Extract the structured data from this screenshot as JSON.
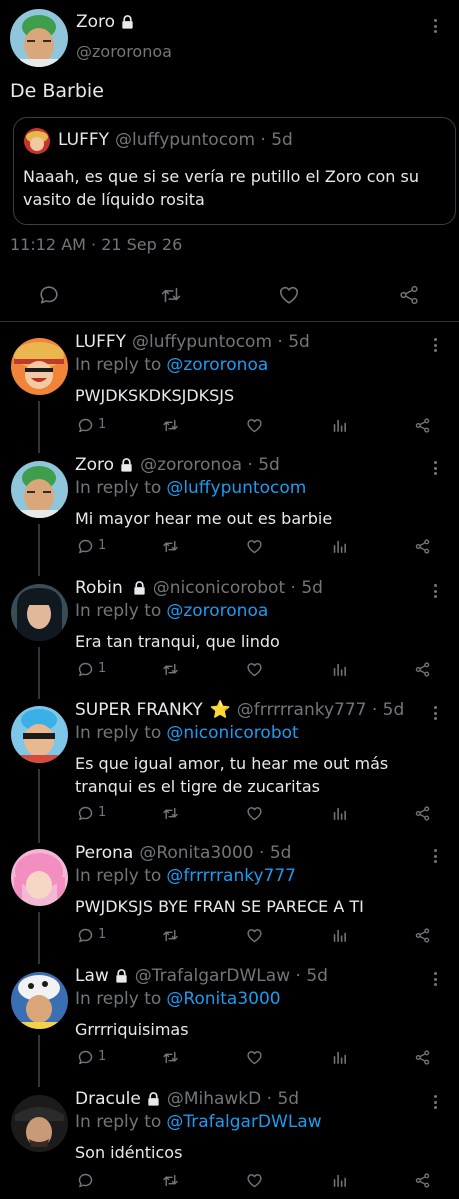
{
  "main_tweet": {
    "name": "Zoro",
    "handle": "@zororonoa",
    "text": "De Barbie",
    "timestamp": "11:12 AM · 21 Sep 26",
    "quoted": {
      "name": "LUFFY",
      "handle": "@luffypuntocom · 5d",
      "text": "Naaah,  es que si se vería re putillo el Zoro con su vasito de líquido rosita"
    },
    "actions": [
      "reply-icon",
      "retweet-icon",
      "like-icon",
      "share-icon"
    ]
  },
  "replies": [
    {
      "name": "LUFFY",
      "locked": false,
      "badge": "",
      "handle": "@luffypuntocom · 5d",
      "in_reply_prefix": "In reply to",
      "in_reply_to": "@zororonoa",
      "text": "PWJDKSKDKSJDKSJS",
      "reply_count": "1"
    },
    {
      "name": "Zoro",
      "locked": true,
      "badge": "",
      "handle": "@zororonoa · 5d",
      "in_reply_prefix": "In reply to",
      "in_reply_to": "@luffypuntocom",
      "text": "Mi mayor hear me out es barbie",
      "reply_count": "1"
    },
    {
      "name": "Robin",
      "locked": true,
      "badge": "",
      "handle": "@niconicorobot · 5d",
      "in_reply_prefix": "In reply to",
      "in_reply_to": "@zororonoa",
      "text": "Era tan tranqui,  que lindo",
      "reply_count": "1"
    },
    {
      "name": "SUPER FRANKY",
      "locked": false,
      "badge": "⭐",
      "handle": "@frrrrranky777 · 5d",
      "in_reply_prefix": "In reply to",
      "in_reply_to": "@niconicorobot",
      "text": "Es que igual amor,  tu hear me out más tranqui es el tigre de zucaritas",
      "reply_count": "1"
    },
    {
      "name": "Perona",
      "locked": false,
      "badge": "",
      "handle": "@Ronita3000 · 5d",
      "in_reply_prefix": "In reply to",
      "in_reply_to": "@frrrrranky777",
      "text": "PWJDKSJS BYE FRAN SE PARECE A TI",
      "reply_count": "1"
    },
    {
      "name": "Law",
      "locked": true,
      "badge": "",
      "handle": "@TrafalgarDWLaw · 5d",
      "in_reply_prefix": "In reply to",
      "in_reply_to": "@Ronita3000",
      "text": "Grrrriquisimas",
      "reply_count": "1"
    },
    {
      "name": "Dracule",
      "locked": true,
      "badge": "",
      "handle": "@MihawkD · 5d",
      "in_reply_prefix": "In reply to",
      "in_reply_to": "@TrafalgarDWLaw",
      "text": "Son idénticos",
      "reply_count": ""
    }
  ],
  "colors": {
    "background": "#000000",
    "text_primary": "#e7e9ea",
    "text_secondary": "#71767b",
    "link": "#1d9bf0",
    "divider": "#2f3336"
  }
}
